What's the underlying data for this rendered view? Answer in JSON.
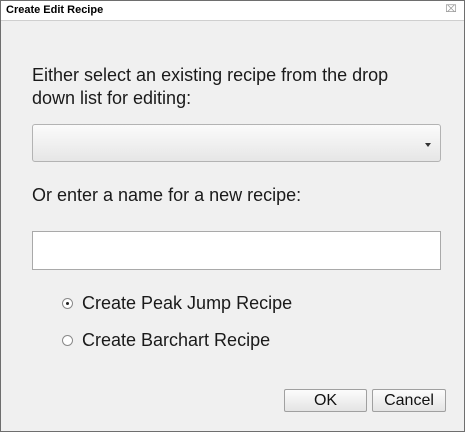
{
  "dialog": {
    "title": "Create Edit Recipe",
    "close_glyph": "⌧"
  },
  "existing": {
    "prompt": "Either select an existing recipe from the drop down list for editing:",
    "selected_value": ""
  },
  "new_recipe": {
    "prompt": "Or enter a name for a new recipe:",
    "value": "",
    "placeholder": ""
  },
  "recipe_type": {
    "options": [
      {
        "label": "Create Peak Jump Recipe",
        "checked": true
      },
      {
        "label": "Create Barchart Recipe",
        "checked": false
      }
    ]
  },
  "buttons": {
    "ok_label": "OK",
    "cancel_label": "Cancel"
  }
}
